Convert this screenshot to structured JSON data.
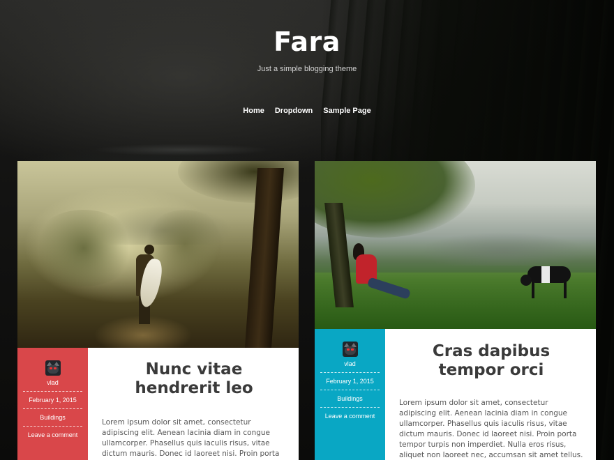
{
  "site": {
    "title": "Fara",
    "description": "Just a simple blogging theme"
  },
  "nav": {
    "items": [
      "Home",
      "Dropdown",
      "Sample Page"
    ]
  },
  "colors": {
    "left_meta": "#d9474a",
    "right_meta": "#09a7c4"
  },
  "posts": [
    {
      "title": "Nunc vitae hendrerit leo",
      "author": "vlad",
      "date": "February 1, 2015",
      "category": "Buildings",
      "comment_link": "Leave a comment",
      "excerpt": "Lorem ipsum dolor sit amet, consectetur adipiscing elit. Aenean lacinia diam in congue ullamcorper. Phasellus quis iaculis risus, vitae dictum mauris. Donec id laoreet nisi. Proin porta tempor turpis non imperdiet. Nulla eros risus, aliquet non laoreet nec,"
    },
    {
      "title": "Cras dapibus tempor orci",
      "author": "vlad",
      "date": "February 1, 2015",
      "category": "Buildings",
      "comment_link": "Leave a comment",
      "excerpt": "Lorem ipsum dolor sit amet, consectetur adipiscing elit. Aenean lacinia diam in congue ullamcorper. Phasellus quis iaculis risus, vitae dictum mauris. Donec id laoreet nisi. Proin porta tempor turpis non imperdiet. Nulla eros risus, aliquet non laoreet nec, accumsan sit amet tellus. Mauris vitae odio elit. Mauris tellus est, fermentum in molestie placerat,"
    }
  ]
}
